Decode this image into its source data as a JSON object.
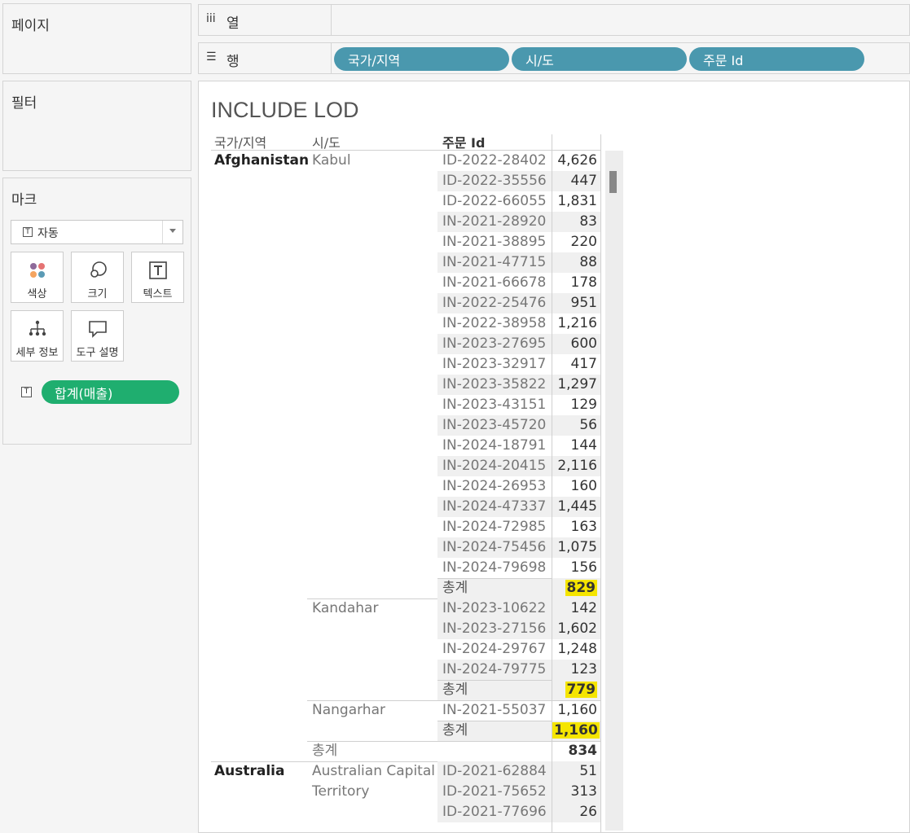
{
  "panels": {
    "pages_title": "페이지",
    "filters_title": "필터",
    "marks_title": "마크"
  },
  "marks": {
    "type_icon": "T",
    "type_label": "자동",
    "buttons": [
      {
        "label": "색상",
        "icon": "color-dots-icon"
      },
      {
        "label": "크기",
        "icon": "size-circles-icon"
      },
      {
        "label": "텍스트",
        "icon": "text-box-icon"
      },
      {
        "label": "세부 정보",
        "icon": "detail-hierarchy-icon"
      },
      {
        "label": "도구 설명",
        "icon": "tooltip-bubble-icon"
      }
    ],
    "measure_icon": "T",
    "measure_pill": "합계(매출)"
  },
  "shelves": {
    "columns": {
      "symbol": "iii",
      "label": "열"
    },
    "rows": {
      "symbol": "☰",
      "label": "행"
    },
    "row_pills": [
      "국가/지역",
      "시/도",
      "주문 Id"
    ]
  },
  "colors": {
    "row_pill": "#4a98ae",
    "measure_pill": "#1fae6f",
    "highlight": "#f5e500"
  },
  "view": {
    "title": "INCLUDE LOD",
    "headers": [
      "국가/지역",
      "시/도",
      "주문 Id"
    ],
    "total_label": "총계",
    "rows": [
      {
        "country": "Afghanistan",
        "state": "Kabul",
        "order": "ID-2022-28402",
        "value": "4,626"
      },
      {
        "order": "ID-2022-35556",
        "value": "447"
      },
      {
        "order": "ID-2022-66055",
        "value": "1,831"
      },
      {
        "order": "IN-2021-28920",
        "value": "83"
      },
      {
        "order": "IN-2021-38895",
        "value": "220"
      },
      {
        "order": "IN-2021-47715",
        "value": "88"
      },
      {
        "order": "IN-2021-66678",
        "value": "178"
      },
      {
        "order": "IN-2022-25476",
        "value": "951"
      },
      {
        "order": "IN-2022-38958",
        "value": "1,216"
      },
      {
        "order": "IN-2023-27695",
        "value": "600"
      },
      {
        "order": "IN-2023-32917",
        "value": "417"
      },
      {
        "order": "IN-2023-35822",
        "value": "1,297"
      },
      {
        "order": "IN-2023-43151",
        "value": "129"
      },
      {
        "order": "IN-2023-45720",
        "value": "56"
      },
      {
        "order": "IN-2024-18791",
        "value": "144"
      },
      {
        "order": "IN-2024-20415",
        "value": "2,116"
      },
      {
        "order": "IN-2024-26953",
        "value": "160"
      },
      {
        "order": "IN-2024-47337",
        "value": "1,445"
      },
      {
        "order": "IN-2024-72985",
        "value": "163"
      },
      {
        "order": "IN-2024-75456",
        "value": "1,075"
      },
      {
        "order": "IN-2024-79698",
        "value": "156"
      },
      {
        "order": "총계",
        "value": "829",
        "subtotal": true,
        "highlight": true
      },
      {
        "state": "Kandahar",
        "order": "IN-2023-10622",
        "value": "142"
      },
      {
        "order": "IN-2023-27156",
        "value": "1,602"
      },
      {
        "order": "IN-2024-29767",
        "value": "1,248"
      },
      {
        "order": "IN-2024-79775",
        "value": "123"
      },
      {
        "order": "총계",
        "value": "779",
        "subtotal": true,
        "highlight": true
      },
      {
        "state": "Nangarhar",
        "order": "IN-2021-55037",
        "value": "1,160"
      },
      {
        "order": "총계",
        "value": "1,160",
        "subtotal": true,
        "highlight": true
      },
      {
        "state": "총계",
        "value": "834",
        "country_total": true
      },
      {
        "country": "Australia",
        "state": "Australian Capital",
        "order": "ID-2021-62884",
        "value": "51"
      },
      {
        "state": "Territory",
        "order": "ID-2021-75652",
        "value": "313"
      },
      {
        "order": "ID-2021-77696",
        "value": "26"
      }
    ]
  }
}
